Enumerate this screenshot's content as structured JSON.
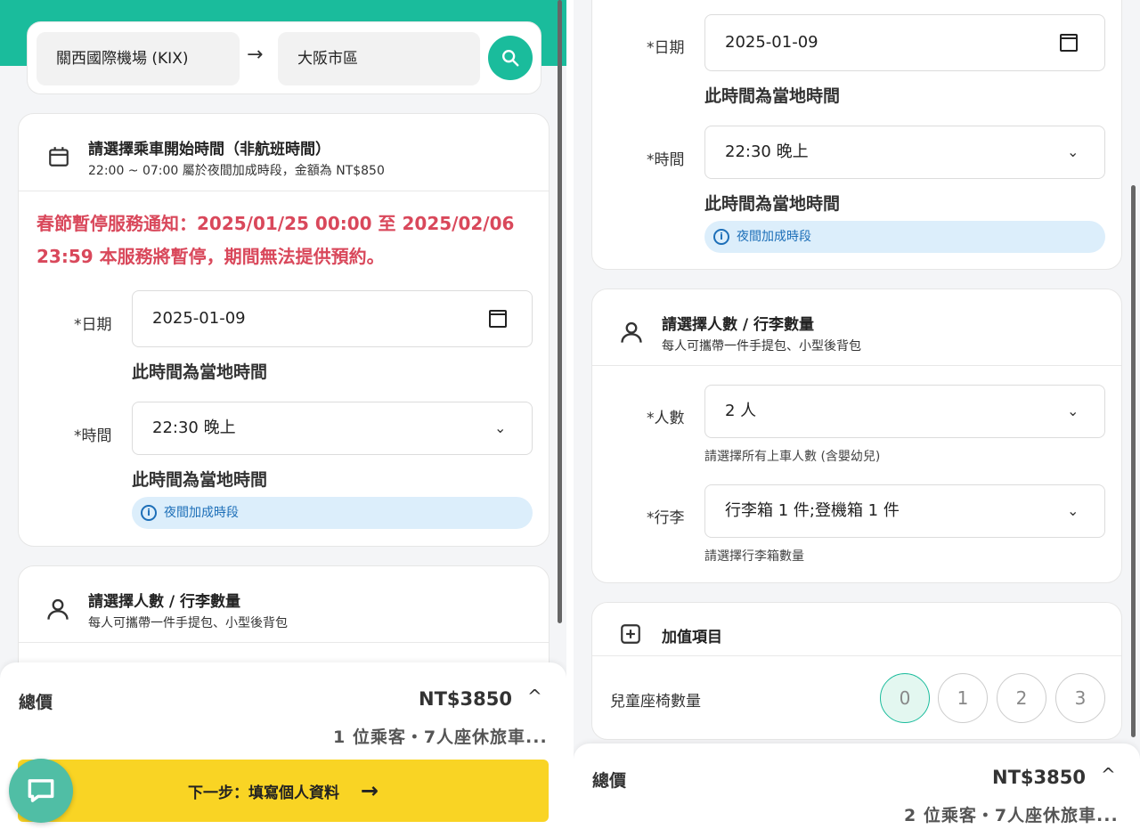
{
  "search": {
    "from": "關西國際機場 (KIX)",
    "to": "大阪市區"
  },
  "time_card": {
    "title": "請選擇乘車開始時間（非航班時間）",
    "subtitle": "22:00 ~ 07:00 屬於夜間加成時段，金額為 NT$850",
    "notice": "春節暫停服務通知：2025/01/25 00:00 至 2025/02/06 23:59 本服務將暫停，期間無法提供預約。",
    "date_label": "*日期",
    "date_value": "2025-01-09",
    "date_hint": "此時間為當地時間",
    "time_label": "*時間",
    "time_value": "22:30 晚上",
    "time_hint": "此時間為當地時間",
    "night_chip": "夜間加成時段"
  },
  "people_card": {
    "title": "請選擇人數 / 行李數量",
    "subtitle": "每人可攜帶一件手提包、小型後背包",
    "people_label": "*人數",
    "people_value": "2 人",
    "people_hint": "請選擇所有上車人數 (含嬰幼兒)",
    "luggage_label": "*行李",
    "luggage_value": "行李箱 1 件;登機箱 1 件",
    "luggage_hint": "請選擇行李箱數量"
  },
  "addon_card": {
    "title": "加值項目",
    "child_seat_label": "兒童座椅數量",
    "options": [
      "0",
      "1",
      "2",
      "3"
    ],
    "selected": "0"
  },
  "footer_left": {
    "total_label": "總價",
    "total_amount": "NT$3850",
    "summary": "1 位乘客・7人座休旅車...",
    "next_button": "下一步：填寫個人資料"
  },
  "footer_right": {
    "total_label": "總價",
    "total_amount": "NT$3850",
    "summary": "2 位乘客・7人座休旅車..."
  },
  "colors": {
    "accent": "#1abc9c",
    "notice": "#d9485b",
    "button": "#f9d424",
    "chip_bg": "#dceefb"
  }
}
